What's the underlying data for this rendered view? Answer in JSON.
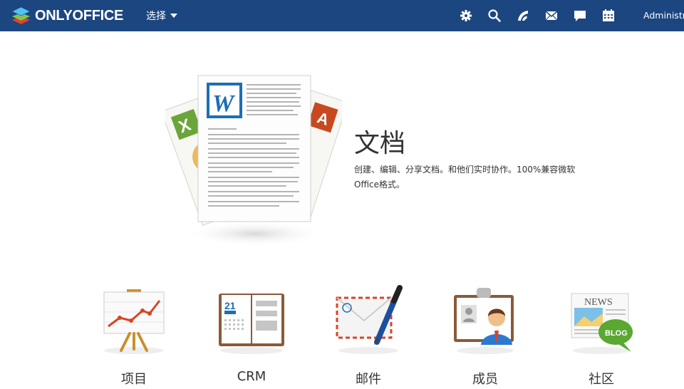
{
  "header": {
    "brand": "ONLYOFFICE",
    "nav_select_label": "选择",
    "icons": [
      "settings-icon",
      "search-icon",
      "feed-icon",
      "mail-icon",
      "chat-icon",
      "calendar-icon"
    ],
    "user_name": "Administrator",
    "bar_color": "#1c4680"
  },
  "hero": {
    "title": "文档",
    "description": "创建、编辑、分享文档。和他们实时协作。100%兼容微软Office格式。"
  },
  "modules": [
    {
      "label": "项目",
      "icon": "projects-chart-icon"
    },
    {
      "label": "CRM",
      "icon": "crm-calendar-book-icon"
    },
    {
      "label": "邮件",
      "icon": "mail-envelope-pen-icon"
    },
    {
      "label": "成员",
      "icon": "people-badge-icon"
    },
    {
      "label": "社区",
      "icon": "community-news-blog-icon"
    }
  ]
}
